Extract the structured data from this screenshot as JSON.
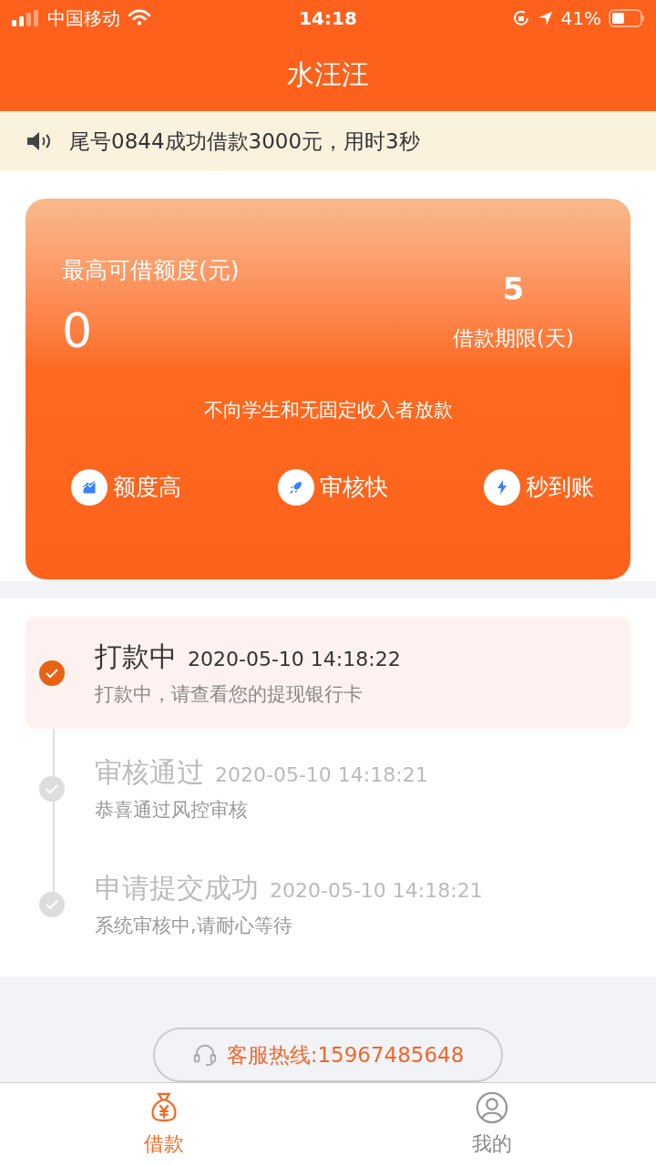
{
  "status_bar": {
    "carrier": "中国移动",
    "time": "14:18",
    "battery": "41%"
  },
  "header": {
    "title": "水汪汪"
  },
  "notice": {
    "text": "尾号0844成功借款3000元，用时3秒"
  },
  "card": {
    "limit_label": "最高可借额度(元)",
    "limit_value": "0",
    "term_value": "5",
    "term_label": "借款期限(天)",
    "disclaimer": "不向学生和无固定收入者放款",
    "features": [
      {
        "kind": "chart",
        "label": "额度高"
      },
      {
        "kind": "rocket",
        "label": "审核快"
      },
      {
        "kind": "bolt",
        "label": "秒到账"
      }
    ]
  },
  "timeline": [
    {
      "title": "打款中",
      "time": "2020-05-10 14:18:22",
      "detail": "打款中，请查看您的提现银行卡",
      "current": true
    },
    {
      "title": "审核通过",
      "time": "2020-05-10 14:18:21",
      "detail": "恭喜通过风控审核",
      "current": false
    },
    {
      "title": "申请提交成功",
      "time": "2020-05-10 14:18:21",
      "detail": "系统审核中,请耐心等待",
      "current": false
    }
  ],
  "hotline": {
    "text": "客服热线:15967485648"
  },
  "tabs": [
    {
      "kind": "loan",
      "label": "借款",
      "selected": true
    },
    {
      "kind": "me",
      "label": "我的",
      "selected": false
    }
  ]
}
